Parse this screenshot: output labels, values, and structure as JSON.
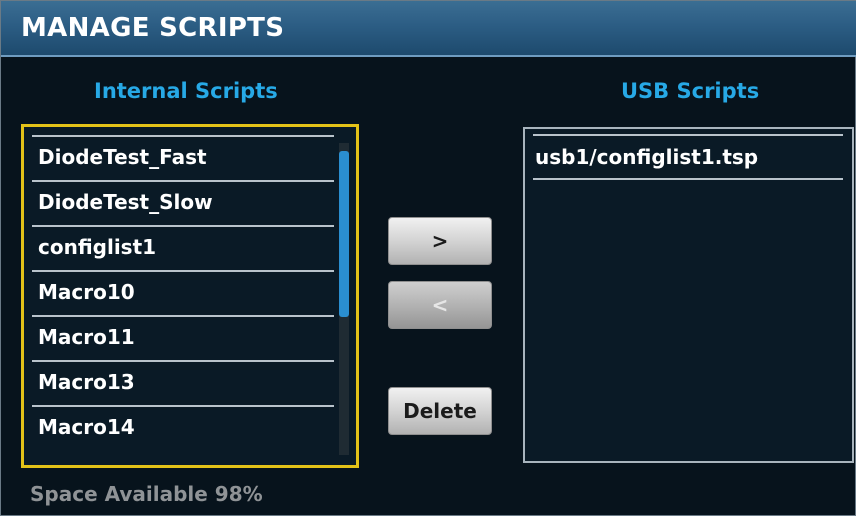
{
  "title": "MANAGE SCRIPTS",
  "internal": {
    "heading": "Internal Scripts",
    "items": [
      {
        "label": "DiodeTest_Fast"
      },
      {
        "label": "DiodeTest_Slow"
      },
      {
        "label": "configlist1"
      },
      {
        "label": "Macro10"
      },
      {
        "label": "Macro11"
      },
      {
        "label": "Macro13"
      },
      {
        "label": "Macro14"
      }
    ]
  },
  "usb": {
    "heading": "USB Scripts",
    "items": [
      {
        "label": "usb1/configlist1.tsp"
      }
    ]
  },
  "buttons": {
    "copy_to_usb": ">",
    "copy_to_internal": "<",
    "delete": "Delete"
  },
  "status": {
    "space_available": "Space Available 98%"
  },
  "colors": {
    "title_bar": "#2c5d84",
    "heading_accent": "#27a9e6",
    "selection_border": "#e3c218",
    "scroll_thumb": "#2a8ed0",
    "background": "#07131c"
  }
}
